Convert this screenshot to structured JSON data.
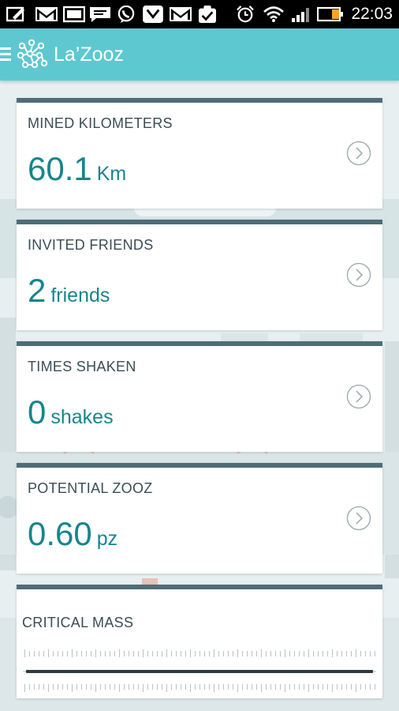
{
  "status_bar": {
    "time": "22:03",
    "icons": [
      "edit-icon",
      "gmail-icon",
      "image-icon",
      "message-icon",
      "viber-icon",
      "download-icon",
      "gmail-icon",
      "clipboard-check-icon",
      "alarm-icon",
      "wifi-icon",
      "signal-icon",
      "battery-icon"
    ]
  },
  "app_bar": {
    "title": "La’Zooz",
    "menu_icon": "hamburger-menu-icon",
    "logo_icon": "lazooz-logo-icon"
  },
  "cards": [
    {
      "label": "MINED KILOMETERS",
      "value": "60.1",
      "unit": "Km"
    },
    {
      "label": "INVITED FRIENDS",
      "value": "2",
      "unit": "friends"
    },
    {
      "label": "TIMES SHAKEN",
      "value": "0",
      "unit": "shakes"
    },
    {
      "label": "POTENTIAL ZOOZ",
      "value": "0.60",
      "unit": "pz"
    }
  ],
  "critical_mass": {
    "label": "CRITICAL MASS",
    "progress": 1.0
  },
  "colors": {
    "app_bar": "#5ec8d0",
    "accent_value": "#17858c",
    "card_top": "#4f6d77",
    "label_text": "#3a4d55"
  }
}
